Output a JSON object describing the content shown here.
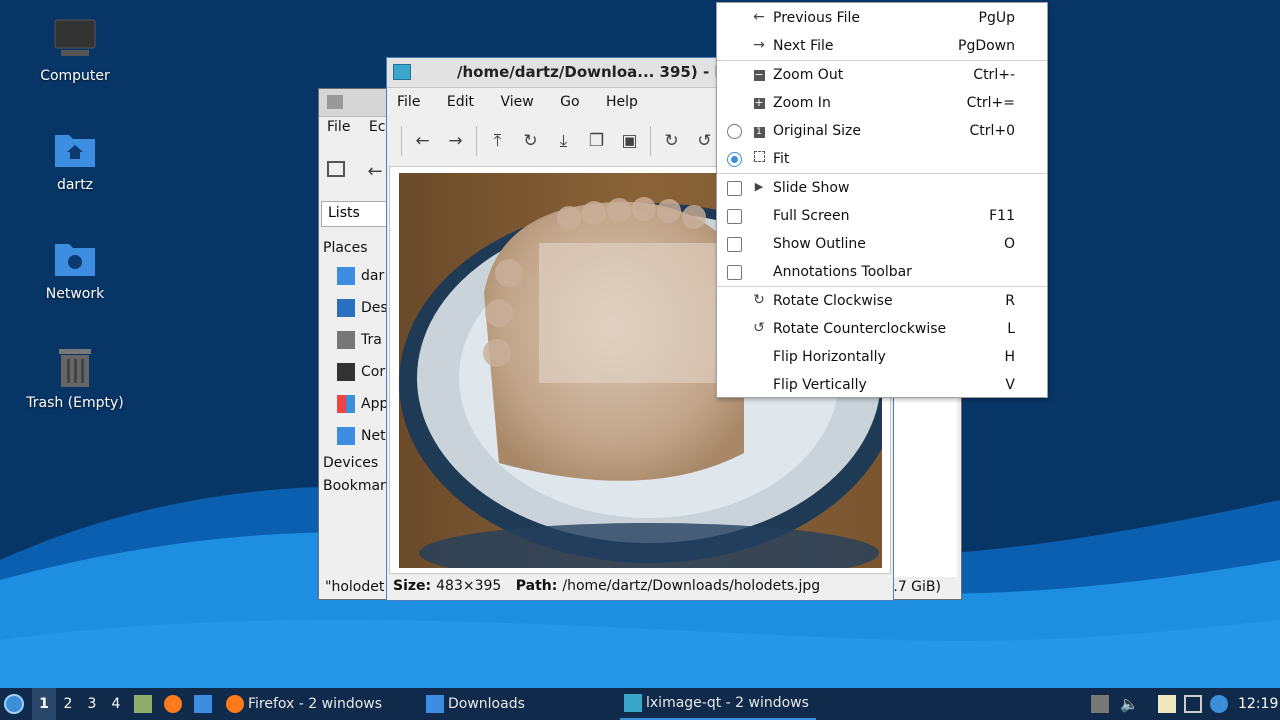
{
  "desktop": {
    "icons": [
      {
        "label": "Computer",
        "icon": "computer-icon"
      },
      {
        "label": "dartz",
        "icon": "home-folder-icon"
      },
      {
        "label": "Network",
        "icon": "network-folder-icon"
      },
      {
        "label": "Trash (Empty)",
        "icon": "trash-icon"
      }
    ]
  },
  "file_manager": {
    "menu": [
      "File",
      "Ec"
    ],
    "view_selector": "Lists",
    "sidebar": {
      "places_header": "Places",
      "items": [
        "dar",
        "Des",
        "Tra",
        "Cor",
        "App",
        "Net"
      ],
      "devices_header": "Devices",
      "bookmarks_header": "Bookmar"
    },
    "status_left": "\"holodet",
    "status_right": ".7 GiB)"
  },
  "image_viewer": {
    "title": "/home/dartz/Downloa... 395) - I",
    "menu": [
      "File",
      "Edit",
      "View",
      "Go",
      "Help"
    ],
    "status": {
      "size_label": "Size:",
      "size_value": "483×395",
      "path_label": "Path:",
      "path_value": "/home/dartz/Downloads/holodets.jpg"
    }
  },
  "context_menu": {
    "items": [
      {
        "label": "Previous File",
        "shortcut": "PgUp",
        "icon": "arrow-left-icon"
      },
      {
        "label": "Next File",
        "shortcut": "PgDown",
        "icon": "arrow-right-icon"
      },
      {
        "label": "Zoom Out",
        "shortcut": "Ctrl+-",
        "icon": "zoom-out-icon"
      },
      {
        "label": "Zoom In",
        "shortcut": "Ctrl+=",
        "icon": "zoom-in-icon"
      },
      {
        "label": "Original Size",
        "shortcut": "Ctrl+0",
        "icon": "original-size-icon"
      },
      {
        "label": "Fit",
        "shortcut": "",
        "icon": "fit-icon"
      },
      {
        "label": "Slide Show",
        "shortcut": "",
        "icon": "play-icon"
      },
      {
        "label": "Full Screen",
        "shortcut": "F11"
      },
      {
        "label": "Show Outline",
        "shortcut": "O"
      },
      {
        "label": "Annotations Toolbar",
        "shortcut": ""
      },
      {
        "label": "Rotate Clockwise",
        "shortcut": "R",
        "icon": "rotate-cw-icon"
      },
      {
        "label": "Rotate Counterclockwise",
        "shortcut": "L",
        "icon": "rotate-ccw-icon"
      },
      {
        "label": "Flip Horizontally",
        "shortcut": "H"
      },
      {
        "label": "Flip Vertically",
        "shortcut": "V"
      }
    ]
  },
  "taskbar": {
    "workspaces": [
      "1",
      "2",
      "3",
      "4"
    ],
    "tasks": [
      {
        "label": "Firefox - 2 windows"
      },
      {
        "label": "Downloads"
      },
      {
        "label": "lximage-qt - 2 windows"
      }
    ],
    "clock": "12:19"
  },
  "colors": {
    "desktop_bg": "#073566",
    "wave_light": "#1e8fe0",
    "accent": "#3a8fd8",
    "taskbar_bg": "#0f2a4a"
  }
}
